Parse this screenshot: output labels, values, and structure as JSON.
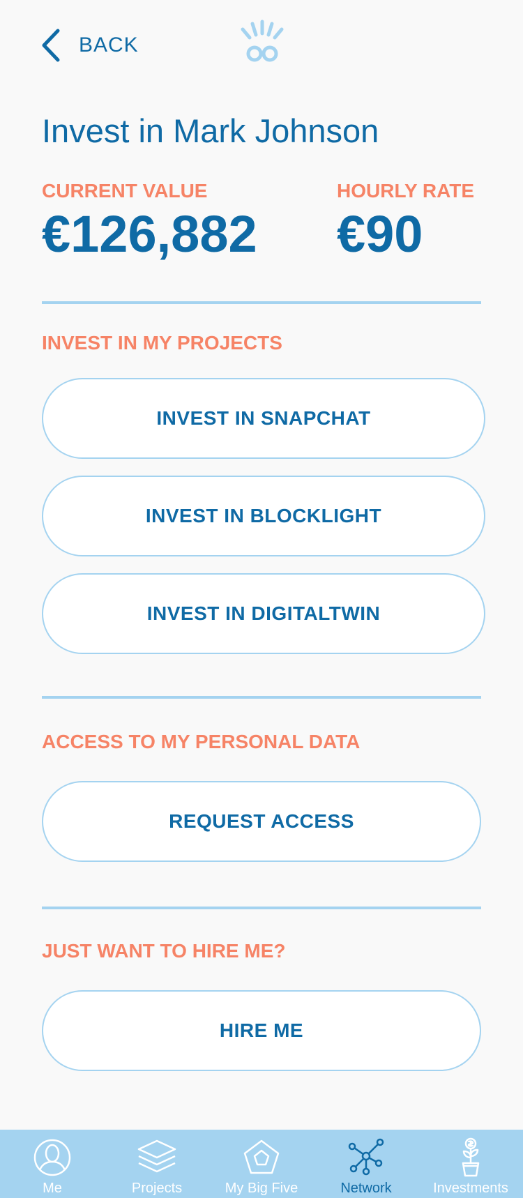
{
  "header": {
    "back_label": "BACK"
  },
  "page": {
    "title": "Invest in Mark Johnson"
  },
  "stats": {
    "current_value_label": "CURRENT VALUE",
    "current_value": "€126,882",
    "hourly_rate_label": "HOURLY RATE",
    "hourly_rate": "€90"
  },
  "projects_section": {
    "label": "INVEST IN MY PROJECTS",
    "buttons": [
      "INVEST IN SNAPCHAT",
      "INVEST IN BLOCKLIGHT",
      "INVEST IN DIGITALTWIN"
    ]
  },
  "data_section": {
    "label": "ACCESS TO MY PERSONAL DATA",
    "button": "REQUEST ACCESS"
  },
  "hire_section": {
    "label": "JUST WANT TO HIRE ME?",
    "button": "HIRE ME"
  },
  "tabbar": {
    "tabs": [
      {
        "label": "Me",
        "icon": "person-icon"
      },
      {
        "label": "Projects",
        "icon": "layers-icon"
      },
      {
        "label": "My Big Five",
        "icon": "pentagon-icon"
      },
      {
        "label": "Network",
        "icon": "network-icon",
        "active": true
      },
      {
        "label": "Investments",
        "icon": "money-plant-icon"
      }
    ]
  },
  "colors": {
    "primary": "#0f6aa5",
    "accent": "#f68366",
    "light_blue": "#a4d3f0",
    "background": "#f9f9f9"
  }
}
